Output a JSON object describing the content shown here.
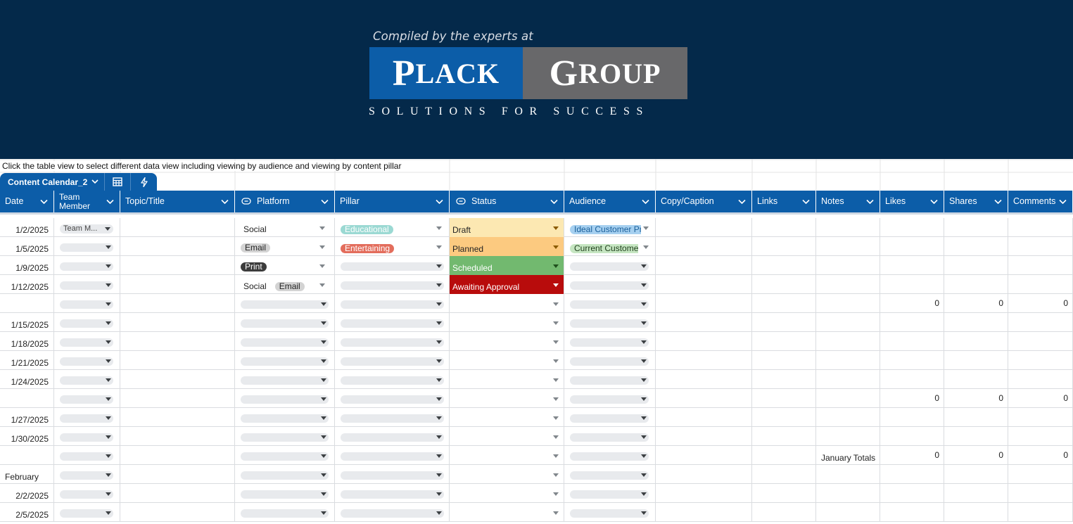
{
  "banner": {
    "compiled_text": "Compiled by the experts at",
    "logo_word1_initial": "P",
    "logo_word1_rest": "LACK",
    "logo_word2_initial": "G",
    "logo_word2_rest": "ROUP",
    "tagline": "SOLUTIONS FOR SUCCESS",
    "colors": {
      "background": "#04294a",
      "plack_box": "#0c5da8",
      "group_box": "#68686a"
    }
  },
  "instruction": "Click the table view to select different data view including viewing by audience and viewing by content pillar",
  "tabs": {
    "view_name": "Content Calendar_2",
    "icons": [
      "table-icon",
      "bolt-icon"
    ]
  },
  "columns": [
    {
      "label": "Date",
      "icon": ""
    },
    {
      "label": "Team Member",
      "icon": ""
    },
    {
      "label": "Topic/Title",
      "icon": ""
    },
    {
      "label": "Platform",
      "icon": "link-chip-icon"
    },
    {
      "label": "Pillar",
      "icon": ""
    },
    {
      "label": "Status",
      "icon": "link-chip-icon"
    },
    {
      "label": "Audience",
      "icon": ""
    },
    {
      "label": "Copy/Caption",
      "icon": ""
    },
    {
      "label": "Links",
      "icon": ""
    },
    {
      "label": "Notes",
      "icon": ""
    },
    {
      "label": "Likes",
      "icon": ""
    },
    {
      "label": "Shares",
      "icon": ""
    },
    {
      "label": "Comments",
      "icon": ""
    }
  ],
  "status_colors": {
    "Draft": "#fce8b2",
    "Planned": "#fcca80",
    "Scheduled": "#72b96f",
    "Awaiting Approval": "#b80c0c"
  },
  "rows": [
    {
      "date": "1/2/2025",
      "team": "Team M...",
      "platform": [
        {
          "t": "Social",
          "s": "plain"
        }
      ],
      "pillar": {
        "t": "Educational",
        "s": "teal"
      },
      "status": "Draft",
      "audience": {
        "t": "Ideal Customer Pr",
        "s": "blue"
      },
      "notes": "",
      "likes": "",
      "shares": "",
      "comments": ""
    },
    {
      "date": "1/5/2025",
      "team": "",
      "platform": [
        {
          "t": "Email",
          "s": "grey"
        }
      ],
      "pillar": {
        "t": "Entertaining",
        "s": "red"
      },
      "status": "Planned",
      "audience": {
        "t": "Current Custome",
        "s": "green"
      },
      "notes": "",
      "likes": "",
      "shares": "",
      "comments": ""
    },
    {
      "date": "1/9/2025",
      "team": "",
      "platform": [
        {
          "t": "Print",
          "s": "dark"
        }
      ],
      "pillar": null,
      "status": "Scheduled",
      "audience": null,
      "notes": "",
      "likes": "",
      "shares": "",
      "comments": ""
    },
    {
      "date": "1/12/2025",
      "team": "",
      "platform": [
        {
          "t": "Social",
          "s": "plain"
        },
        {
          "t": "Email",
          "s": "grey"
        }
      ],
      "pillar": null,
      "status": "Awaiting Approval",
      "audience": null,
      "notes": "",
      "likes": "",
      "shares": "",
      "comments": ""
    },
    {
      "date": "",
      "team": "",
      "platform": [],
      "pillar": null,
      "status": "",
      "audience": null,
      "notes": "",
      "likes": "0",
      "shares": "0",
      "comments": "0"
    },
    {
      "date": "1/15/2025",
      "team": "",
      "platform": [],
      "pillar": null,
      "status": "",
      "audience": null,
      "notes": "",
      "likes": "",
      "shares": "",
      "comments": ""
    },
    {
      "date": "1/18/2025",
      "team": "",
      "platform": [],
      "pillar": null,
      "status": "",
      "audience": null,
      "notes": "",
      "likes": "",
      "shares": "",
      "comments": ""
    },
    {
      "date": "1/21/2025",
      "team": "",
      "platform": [],
      "pillar": null,
      "status": "",
      "audience": null,
      "notes": "",
      "likes": "",
      "shares": "",
      "comments": ""
    },
    {
      "date": "1/24/2025",
      "team": "",
      "platform": [],
      "pillar": null,
      "status": "",
      "audience": null,
      "notes": "",
      "likes": "",
      "shares": "",
      "comments": ""
    },
    {
      "date": "",
      "team": "",
      "platform": [],
      "pillar": null,
      "status": "",
      "audience": null,
      "notes": "",
      "likes": "0",
      "shares": "0",
      "comments": "0"
    },
    {
      "date": "1/27/2025",
      "team": "",
      "platform": [],
      "pillar": null,
      "status": "",
      "audience": null,
      "notes": "",
      "likes": "",
      "shares": "",
      "comments": ""
    },
    {
      "date": "1/30/2025",
      "team": "",
      "platform": [],
      "pillar": null,
      "status": "",
      "audience": null,
      "notes": "",
      "likes": "",
      "shares": "",
      "comments": ""
    },
    {
      "date": "",
      "team": "",
      "platform": [],
      "pillar": null,
      "status": "",
      "audience": null,
      "notes": "January Totals",
      "likes": "0",
      "shares": "0",
      "comments": "0"
    },
    {
      "date": "February",
      "team": "",
      "platform": [],
      "pillar": null,
      "status": "",
      "audience": null,
      "notes": "",
      "likes": "",
      "shares": "",
      "comments": "",
      "date_left": true
    },
    {
      "date": "2/2/2025",
      "team": "",
      "platform": [],
      "pillar": null,
      "status": "",
      "audience": null,
      "notes": "",
      "likes": "",
      "shares": "",
      "comments": ""
    },
    {
      "date": "2/5/2025",
      "team": "",
      "platform": [],
      "pillar": null,
      "status": "",
      "audience": null,
      "notes": "",
      "likes": "",
      "shares": "",
      "comments": ""
    }
  ]
}
